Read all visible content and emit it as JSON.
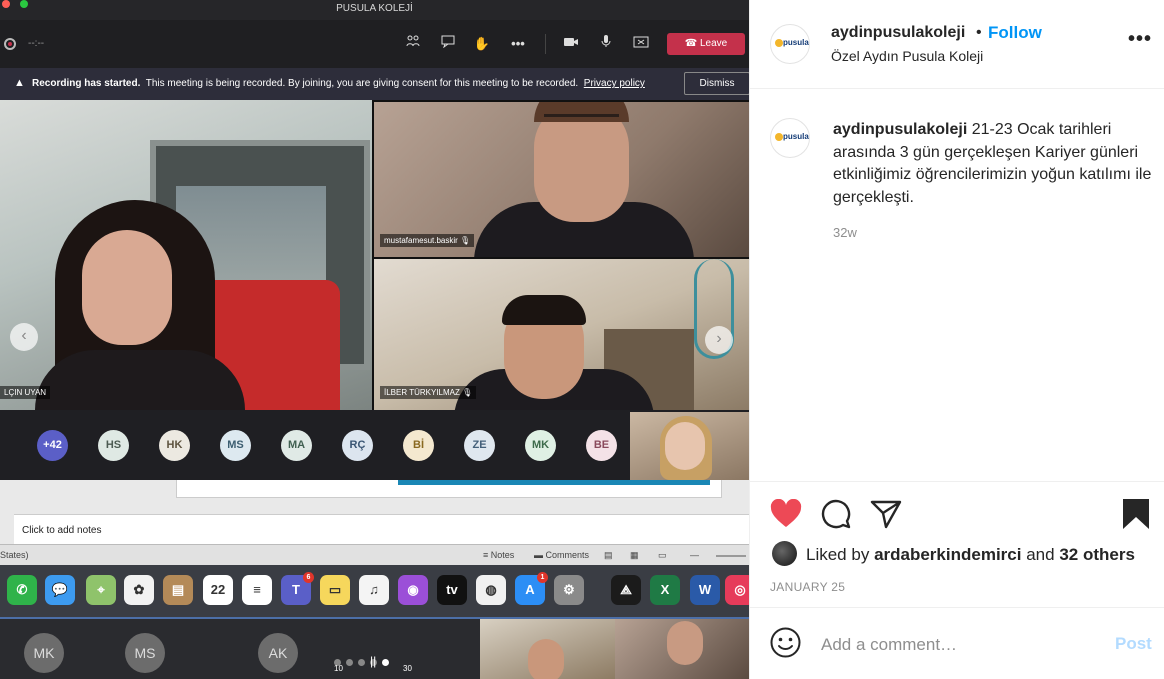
{
  "meeting": {
    "window_title": "PUSULA KOLEJİ",
    "timer": "--:--",
    "leave_label": "Leave",
    "banner": {
      "bold": "Recording has started.",
      "text": "This meeting is being recorded. By joining, you are giving consent for this meeting to be recorded.",
      "link": "Privacy policy",
      "dismiss": "Dismiss"
    },
    "tiles": {
      "main_label": "LÇIN UYAN",
      "top_label": "mustafamesut.baskir",
      "bottom_label": "İLBER TÜRKYILMAZ"
    },
    "avatars": [
      {
        "initials": "+42",
        "color": "#5b5fc7",
        "text_color": "#ffffff"
      },
      {
        "initials": "HS",
        "color": "#dfe9e4",
        "text_color": "#4c5b52"
      },
      {
        "initials": "HK",
        "color": "#ece9e1",
        "text_color": "#5e5440"
      },
      {
        "initials": "MS",
        "color": "#dde9f0",
        "text_color": "#3b5d70"
      },
      {
        "initials": "MA",
        "color": "#e0eae6",
        "text_color": "#416152"
      },
      {
        "initials": "RÇ",
        "color": "#dce5ef",
        "text_color": "#3a5674"
      },
      {
        "initials": "Bİ",
        "color": "#f4e8cf",
        "text_color": "#8a6920"
      },
      {
        "initials": "ZE",
        "color": "#dfe7ef",
        "text_color": "#44607a"
      },
      {
        "initials": "MK",
        "color": "#dff0e4",
        "text_color": "#3d6b4b"
      },
      {
        "initials": "BE",
        "color": "#f4e2e7",
        "text_color": "#8a4a5c"
      }
    ],
    "notes_placeholder": "Click to add notes",
    "status": {
      "left": "States)",
      "notes": "Notes",
      "comments": "Comments"
    },
    "dock": [
      {
        "icon": "facetime-icon",
        "glyph": "✆",
        "color": "#2fb34a"
      },
      {
        "icon": "messages-icon",
        "glyph": "💬",
        "color": "#3d9bf0"
      },
      {
        "icon": "maps-icon",
        "glyph": "⌖",
        "color": "#8fc36b"
      },
      {
        "icon": "photos-icon",
        "glyph": "✿",
        "color": "#f2f2f2"
      },
      {
        "icon": "contacts-icon",
        "glyph": "▤",
        "color": "#b48a58"
      },
      {
        "icon": "calendar-icon",
        "glyph": "22",
        "color": "#ffffff"
      },
      {
        "icon": "reminders-icon",
        "glyph": "≡",
        "color": "#ffffff"
      },
      {
        "icon": "teams-icon",
        "glyph": "T",
        "color": "#5a5fc8",
        "badge": "6"
      },
      {
        "icon": "notes-icon",
        "glyph": "▭",
        "color": "#f6d75c"
      },
      {
        "icon": "music-icon",
        "glyph": "♫",
        "color": "#f4f4f4"
      },
      {
        "icon": "podcasts-icon",
        "glyph": "◉",
        "color": "#9b4fd8"
      },
      {
        "icon": "appletv-icon",
        "glyph": "tv",
        "color": "#111111"
      },
      {
        "icon": "chrome-icon",
        "glyph": "◍",
        "color": "#f1f1f1"
      },
      {
        "icon": "appstore-icon",
        "glyph": "A",
        "color": "#2c8ef5",
        "badge": "1"
      },
      {
        "icon": "system-preferences-icon",
        "glyph": "⚙",
        "color": "#8a8a8a"
      },
      {
        "icon": "acrobat-icon",
        "glyph": "⟁",
        "color": "#1b1b1b"
      },
      {
        "icon": "excel-icon",
        "glyph": "X",
        "color": "#1f7a45"
      },
      {
        "icon": "word-icon",
        "glyph": "W",
        "color": "#2a5aa8"
      },
      {
        "icon": "creative-cloud-icon",
        "glyph": "◎",
        "color": "#e63b5a"
      }
    ],
    "call_strip": {
      "avatars": [
        "MK",
        "MS",
        "AK"
      ],
      "skip_back": "10",
      "skip_forward": "30"
    }
  },
  "instagram": {
    "username": "aydinpusulakoleji",
    "follow_label": "Follow",
    "location": "Özel Aydın Pusula Koleji",
    "logo_text": "pusula",
    "caption_user": "aydinpusulakoleji",
    "caption_text": "21-23 Ocak tarihleri arasında 3 gün gerçekleşen Kariyer günleri etkinliğimiz öğrencilerimizin yoğun katılımı ile gerçekleşti.",
    "age": "32w",
    "liked_prefix": "Liked by",
    "liked_user": "ardaberkindemirci",
    "liked_and": "and",
    "liked_others": "32 others",
    "date": "JANUARY 25",
    "comment_placeholder": "Add a comment…",
    "post_label": "Post",
    "colors": {
      "like": "#ed4956",
      "follow": "#0095f6",
      "post_disabled": "#b3dbff"
    }
  }
}
